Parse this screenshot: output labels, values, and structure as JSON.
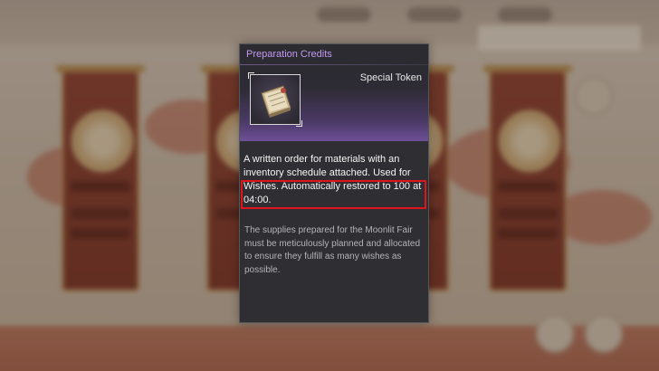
{
  "item": {
    "title": "Preparation Credits",
    "type_label": "Special Token",
    "description": "A written order for materials with an inventory schedule attached. Used for Wishes. Automatically restored to 100 at 04:00.",
    "lore": "The supplies prepared for the Moonlit Fair must be meticulously planned and allocated to ensure they fulfill as many wishes as possible.",
    "icon": "recipe-book-icon",
    "highlighted_text": "Automatically restored to 100 at 04:00."
  },
  "colors": {
    "title": "#c49af2",
    "card_bg": "#2f2f33",
    "header_glow": "#6d4f98",
    "highlight_border": "#e0141b"
  }
}
